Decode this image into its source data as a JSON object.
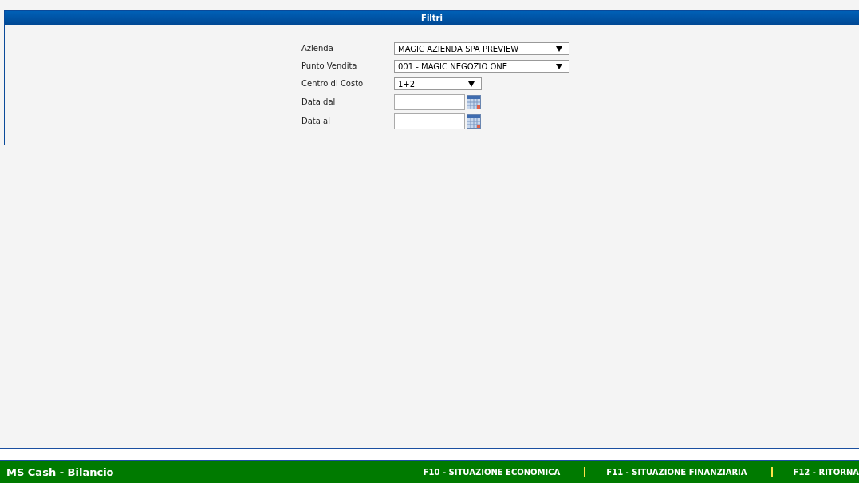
{
  "panel": {
    "title": "Filtri"
  },
  "fields": [
    {
      "label": "Azienda",
      "kind": "select",
      "value": "MAGIC AZIENDA SPA PREVIEW"
    },
    {
      "label": "Punto Vendita",
      "kind": "select",
      "value": "001 - MAGIC NEGOZIO ONE"
    },
    {
      "label": "Centro di Costo",
      "kind": "shortselect",
      "value": "1+2"
    },
    {
      "label": "Data dal",
      "kind": "date"
    },
    {
      "label": "Data al",
      "kind": "date"
    }
  ],
  "footer": {
    "title": "MS Cash - Bilancio",
    "shortcuts": [
      "F10 - SITUAZIONE ECONOMICA",
      "F11 - SITUAZIONE FINANZIARIA",
      "F12 - RITORNA"
    ]
  }
}
